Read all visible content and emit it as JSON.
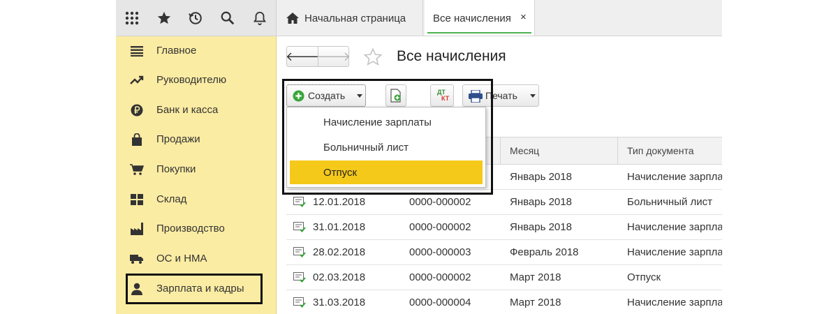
{
  "sidebar": {
    "items": [
      {
        "label": "Главное",
        "icon": "menu-lines-icon"
      },
      {
        "label": "Руководителю",
        "icon": "trend-up-icon"
      },
      {
        "label": "Банк и касса",
        "icon": "ruble-coin-icon"
      },
      {
        "label": "Продажи",
        "icon": "shopping-bag-icon"
      },
      {
        "label": "Покупки",
        "icon": "shopping-cart-icon"
      },
      {
        "label": "Склад",
        "icon": "warehouse-grid-icon"
      },
      {
        "label": "Производство",
        "icon": "factory-icon"
      },
      {
        "label": "ОС и НМА",
        "icon": "truck-icon"
      },
      {
        "label": "Зарплата и кадры",
        "icon": "person-icon"
      }
    ]
  },
  "tabs": {
    "home_label": "Начальная страница",
    "active_label": "Все начисления",
    "close_glyph": "×"
  },
  "header": {
    "back_glyph": "🡐",
    "forward_glyph": "🡒",
    "title": "Все начисления"
  },
  "toolbar": {
    "create_label": "Создать",
    "print_label": "Печать",
    "dt_label": "ДТ",
    "kt_label": "КТ"
  },
  "dropdown": {
    "items": [
      "Начисление зарплаты",
      "Больничный лист",
      "Отпуск"
    ],
    "selected_index": 2
  },
  "table": {
    "columns": [
      "Месяц",
      "Тип документа"
    ],
    "rows": [
      {
        "date": "",
        "number": "",
        "month": "Январь 2018",
        "type": "Начисление зарплаты"
      },
      {
        "date": "12.01.2018",
        "number": "0000-000002",
        "month": "Январь 2018",
        "type": "Больничный лист"
      },
      {
        "date": "31.01.2018",
        "number": "0000-000002",
        "month": "Январь 2018",
        "type": "Начисление зарплаты"
      },
      {
        "date": "28.02.2018",
        "number": "0000-000003",
        "month": "Февраль 2018",
        "type": "Начисление зарплаты"
      },
      {
        "date": "02.03.2018",
        "number": "0000-000002",
        "month": "Март 2018",
        "type": "Отпуск"
      },
      {
        "date": "31.03.2018",
        "number": "0000-000004",
        "month": "Март 2018",
        "type": "Начисление зарплаты"
      }
    ]
  },
  "colors": {
    "sidebar_bg": "#fbeca3",
    "selected_menu_bg": "#f5c91a",
    "tab_underline": "#4fb04f",
    "doc_icon_check": "#3aa63a"
  }
}
